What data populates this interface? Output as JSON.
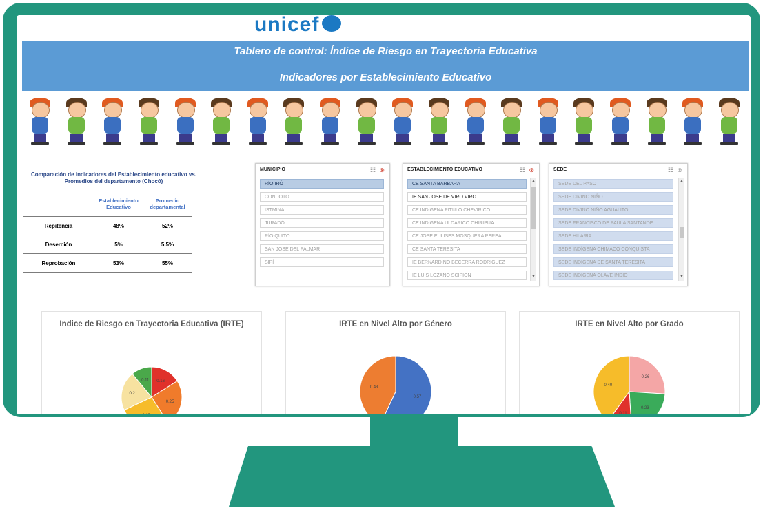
{
  "header": {
    "logo": "unicef",
    "title": "Tablero de control: Índice de Riesgo en Trayectoria Educativa",
    "subtitle": "Indicadores por Establecimiento Educativo"
  },
  "comparison": {
    "title": "Comparación de indicadores del Establecimiento educativo vs. Promedios del departamento (Chocó)",
    "col_headers": [
      "Establecimiento Educativo",
      "Promedio departamental"
    ],
    "rows": [
      {
        "label": "Repitencia",
        "est": "48%",
        "dep": "52%"
      },
      {
        "label": "Deserción",
        "est": "5%",
        "dep": "5.5%"
      },
      {
        "label": "Reprobación",
        "est": "53%",
        "dep": "55%"
      }
    ]
  },
  "slicers": {
    "municipio": {
      "header": "MUNICIPIO",
      "items": [
        "RÍO IRÓ",
        "CONDOTO",
        "ISTMINA",
        "JURADÓ",
        "RÍO QUITO",
        "SAN JOSÉ DEL PALMAR",
        "SIPÍ"
      ]
    },
    "establecimiento": {
      "header": "ESTABLECIMIENTO EDUCATIVO",
      "items": [
        "CE SANTA BARBARA",
        "IE SAN JOSE DE VIRO VIRO",
        "CE INDÍGENA PITULO CHEVIRICO",
        "CE INDÍGENA ULDARICO CHIRIPUA",
        "CE JOSE EULISES MOSQUERA PEREA",
        "CE SANTA TERESITA",
        "IE BERNARDINO BECERRA RODRIGUEZ",
        "IE LUIS LOZANO SCIPION"
      ]
    },
    "sede": {
      "header": "SEDE",
      "items": [
        "SEDE DEL PASO",
        "SEDE DIVINO NIÑO",
        "SEDE DIVINO NIÑO AGUALITO",
        "SEDE FRANCISCO DE PAULA SANTANDE...",
        "SEDE HILARIA",
        "SEDE INDÍGENA CHIMACO CONQUISTA",
        "SEDE INDÍGENA DE SANTA TERESITA",
        "SEDE INDÍGENA OLAVE INDIO"
      ]
    }
  },
  "chart_data": [
    {
      "type": "pie",
      "title": "Indice de Riesgo en Trayectoria Educativa (IRTE)",
      "slices": [
        {
          "value": 0.16,
          "color": "#e0312b"
        },
        {
          "value": 0.25,
          "color": "#f07b2b"
        },
        {
          "value": 0.27,
          "color": "#f6bc2a"
        },
        {
          "value": 0.21,
          "color": "#f7e2a0"
        },
        {
          "value": 0.11,
          "color": "#4aa84a"
        }
      ],
      "labels": [
        "0.16",
        "0.25",
        "0.27",
        "0.21",
        "0.11"
      ]
    },
    {
      "type": "pie",
      "title": "IRTE en Nivel Alto por Género",
      "slices": [
        {
          "value": 0.57,
          "color": "#4472c4"
        },
        {
          "value": 0.43,
          "color": "#ed7d31"
        }
      ],
      "labels": [
        "0.57",
        "0.43"
      ]
    },
    {
      "type": "pie",
      "title": "IRTE en Nivel Alto por Grado",
      "slices": [
        {
          "value": 0.26,
          "color": "#f4a6a6"
        },
        {
          "value": 0.23,
          "color": "#3aab5a"
        },
        {
          "value": 0.11,
          "color": "#e0312b"
        },
        {
          "value": 0.4,
          "color": "#f6bc2a"
        }
      ],
      "labels": [
        "0.26",
        "0.23",
        "0.11",
        "0.40"
      ]
    }
  ]
}
